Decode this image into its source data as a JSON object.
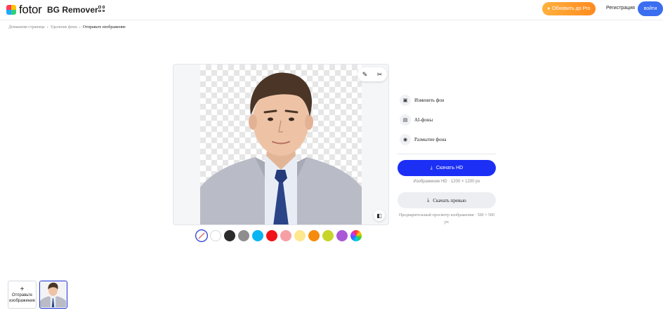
{
  "header": {
    "logo_text": "fotor",
    "product_name": "BG Remover",
    "upgrade_label": "Обновить до Pro",
    "register_label": "Регистрация",
    "login_label": "войти"
  },
  "breadcrumb": {
    "items": [
      "Домашняя страница",
      "Удаление фона",
      "Отправьте изображение"
    ]
  },
  "editor": {
    "tools": [
      "brush-icon",
      "magic-icon"
    ],
    "compare_icon": "compare-icon",
    "swatches": [
      "transparent",
      "#ffffff",
      "#2b2b2b",
      "#8e8e8e",
      "#0ab6f2",
      "#f2131a",
      "#f6a0a6",
      "#fde78f",
      "#f58b0c",
      "#c7d52a",
      "#a959d6",
      "rainbow"
    ],
    "selected_swatch": 0
  },
  "sidebar": {
    "options": [
      {
        "label": "Изменить фон",
        "icon": "background-icon"
      },
      {
        "label": "AI-фоны",
        "icon": "ai-icon"
      },
      {
        "label": "Размытие фона",
        "icon": "blur-icon"
      }
    ],
    "download_hd_label": "Скачать HD",
    "hd_info": "Изображение HD · 1200 × 1200 px",
    "download_preview_label": "Скачать превью",
    "preview_info": "Предварительный просмотр изображения · 500 × 500 px"
  },
  "bottom": {
    "upload_label_1": "Отправьте",
    "upload_label_2": "изображение"
  },
  "colors": {
    "accent": "#1c2ff5",
    "upgrade": "#ff9a2a",
    "login": "#3a6df0"
  }
}
